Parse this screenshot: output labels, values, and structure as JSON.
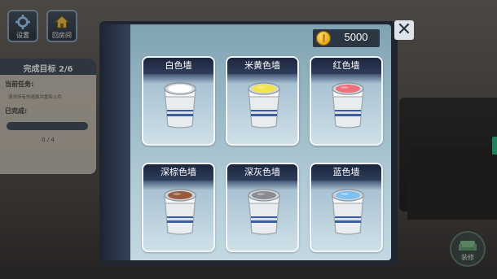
{
  "top_buttons": {
    "settings_label": "设置",
    "home_label": "回房间"
  },
  "task_panel": {
    "header": "完成目标 2/6",
    "current_task_label": "当前任务:",
    "current_task_text": "清洗所有的墙面并重新上色",
    "completed_label": "已完成:",
    "progress_text": "0 / 4",
    "progress": 0.0
  },
  "bottom_button": {
    "label": "装修"
  },
  "shop": {
    "coins": "5000",
    "close_label": "✕",
    "items": [
      {
        "name": "白色墙",
        "paint_color": "#ffffff"
      },
      {
        "name": "米黄色墙",
        "paint_color": "#f2e44b"
      },
      {
        "name": "红色墙",
        "paint_color": "#ef6f7b"
      },
      {
        "name": "深棕色墙",
        "paint_color": "#9a5a3e"
      },
      {
        "name": "深灰色墙",
        "paint_color": "#8a8a90"
      },
      {
        "name": "蓝色墙",
        "paint_color": "#7ec0f0"
      }
    ]
  },
  "colors": {
    "panel_header": "#3d4b5a",
    "modal_gradient_top": "#7fa3b2",
    "coin_box": "#2b3643"
  }
}
